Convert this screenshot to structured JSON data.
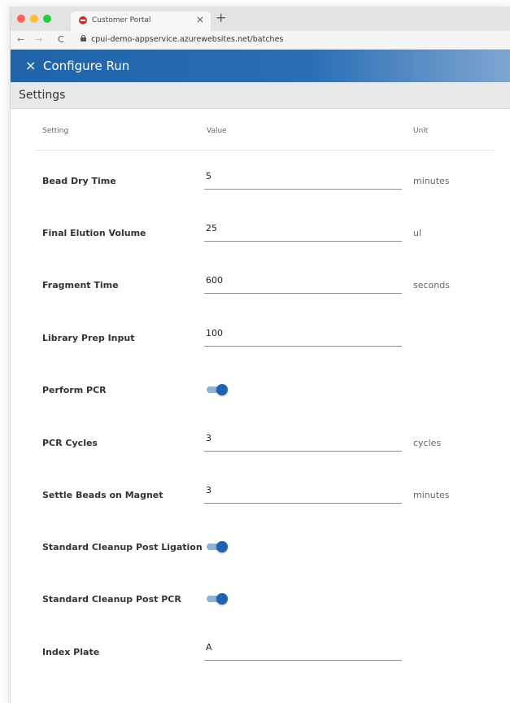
{
  "browser": {
    "tab_title": "Customer Portal",
    "tab_close": "×",
    "new_tab": "+",
    "nav_back": "←",
    "nav_forward": "→",
    "reload": "C",
    "url": "cpui-demo-appservice.azurewebsites.net/batches"
  },
  "app": {
    "close_glyph": "×",
    "title": "Configure Run"
  },
  "section": {
    "title": "Settings"
  },
  "table": {
    "headers": {
      "setting": "Setting",
      "value": "Value",
      "unit": "Unit"
    },
    "rows": [
      {
        "label": "Bead Dry Time",
        "value": "5",
        "unit": "minutes"
      },
      {
        "label": "Final Elution Volume",
        "value": "25",
        "unit": "ul"
      },
      {
        "label": "Fragment Time",
        "value": "600",
        "unit": "seconds"
      },
      {
        "label": "Library Prep Input",
        "value": "100",
        "unit": ""
      },
      {
        "label": "Perform PCR",
        "toggle": true
      },
      {
        "label": "PCR Cycles",
        "value": "3",
        "unit": "cycles"
      },
      {
        "label": "Settle Beads on Magnet",
        "value": "3",
        "unit": "minutes"
      },
      {
        "label": "Standard Cleanup Post Ligation",
        "toggle": true
      },
      {
        "label": "Standard Cleanup Post PCR",
        "toggle": true
      },
      {
        "label": "Index Plate",
        "value": "A",
        "unit": ""
      }
    ]
  },
  "colors": {
    "accent": "#1f64aa",
    "toggle_on": "#1d63b0",
    "traffic_red": "#ff5f57",
    "traffic_yellow": "#febc2e",
    "traffic_green": "#28c840"
  }
}
